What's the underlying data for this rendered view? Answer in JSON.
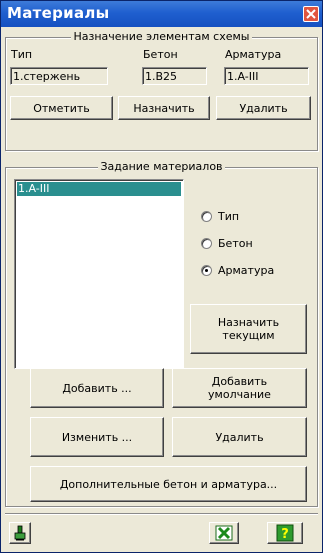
{
  "window": {
    "title": "Материалы"
  },
  "assign_group": {
    "title": "Назначение элементам схемы",
    "labels": {
      "type": "Тип",
      "concrete": "Бетон",
      "rebar": "Арматура"
    },
    "values": {
      "type": "1.стержень",
      "concrete": "1.B25",
      "rebar": "1.A-III"
    },
    "buttons": {
      "mark": "Отметить",
      "assign": "Назначить",
      "delete": "Удалить"
    }
  },
  "materials_group": {
    "title": "Задание материалов",
    "list_items": [
      "1.A-III"
    ],
    "radios": [
      {
        "label": "Тип",
        "checked": false
      },
      {
        "label": "Бетон",
        "checked": false
      },
      {
        "label": "Арматура",
        "checked": true
      }
    ],
    "buttons": {
      "set_current": "Назначить\nтекущим",
      "add": "Добавить ...",
      "add_default": "Добавить\nумолчание",
      "edit": "Изменить ...",
      "delete": "Удалить",
      "extra": "Дополнительные бетон и арматура..."
    }
  },
  "colors": {
    "titlebar": "#1f5fcf",
    "selection": "#2a8f8f",
    "close": "#e1553f",
    "background": "#ece9d8"
  },
  "toolbar": {
    "icons": [
      "paint-bucket-icon",
      "excel-icon",
      "help-icon"
    ]
  }
}
